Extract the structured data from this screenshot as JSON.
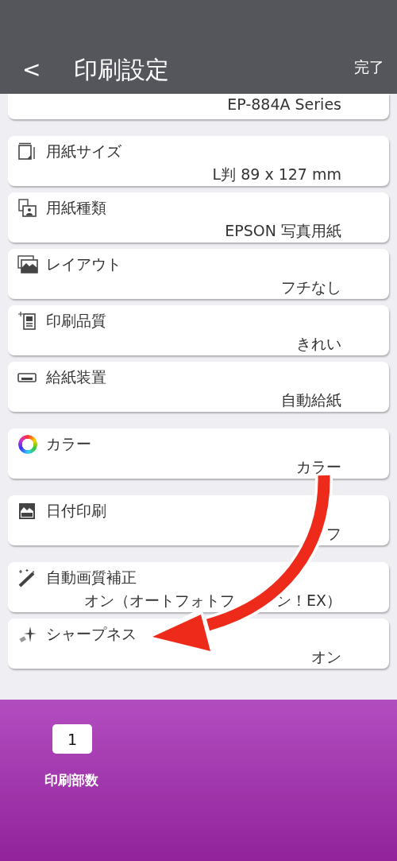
{
  "header": {
    "back": "<",
    "title": "印刷設定",
    "done": "完了"
  },
  "printer": {
    "value": "EP-884A Series"
  },
  "groups": [
    [
      {
        "kind": "paper-size",
        "label": "用紙サイズ",
        "value": [
          "L判 89 x 127 mm"
        ]
      },
      {
        "kind": "paper-type",
        "label": "用紙種類",
        "value": [
          "EPSON 写真用紙"
        ]
      },
      {
        "kind": "layout",
        "label": "レイアウト",
        "value": [
          "フチなし"
        ]
      },
      {
        "kind": "quality",
        "label": "印刷品質",
        "value": [
          "きれい"
        ]
      },
      {
        "kind": "source",
        "label": "給紙装置",
        "value": [
          "自動給紙"
        ]
      }
    ],
    [
      {
        "kind": "color",
        "label": "カラー",
        "value": [
          "カラー"
        ]
      }
    ],
    [
      {
        "kind": "date",
        "label": "日付印刷",
        "value": [
          "フ"
        ]
      }
    ],
    [
      {
        "kind": "wand",
        "label": "自動画質補正",
        "value": [
          "オン（オートフォトフ",
          "ン！EX）"
        ]
      },
      {
        "kind": "sharp",
        "label": "シャープネス",
        "value": [
          "オン"
        ]
      }
    ]
  ],
  "copies": {
    "value": "1",
    "label": "印刷部数"
  },
  "annotation": {
    "kind": "arrow"
  }
}
